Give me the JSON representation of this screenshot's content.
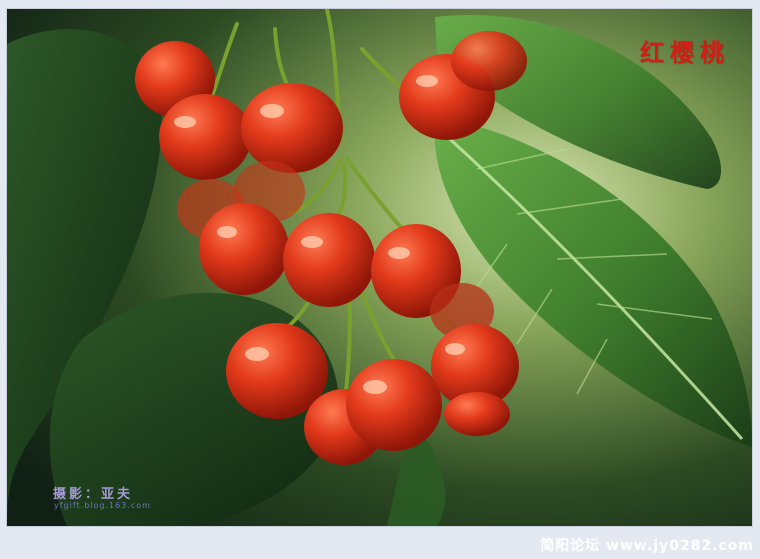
{
  "photo": {
    "subject": "cherries",
    "title_text": "红樱桃",
    "credit_label": "摄影：亚夫",
    "credit_url": "yfgift.blog.163.com"
  },
  "footer": {
    "watermark_text": "简阳论坛 www.jy0282.com"
  },
  "colors": {
    "page_background": "#e4e9f1",
    "cherry_red": "#e23a1b",
    "leaf_green": "#3f7d2d",
    "title_red": "#d21c14"
  }
}
